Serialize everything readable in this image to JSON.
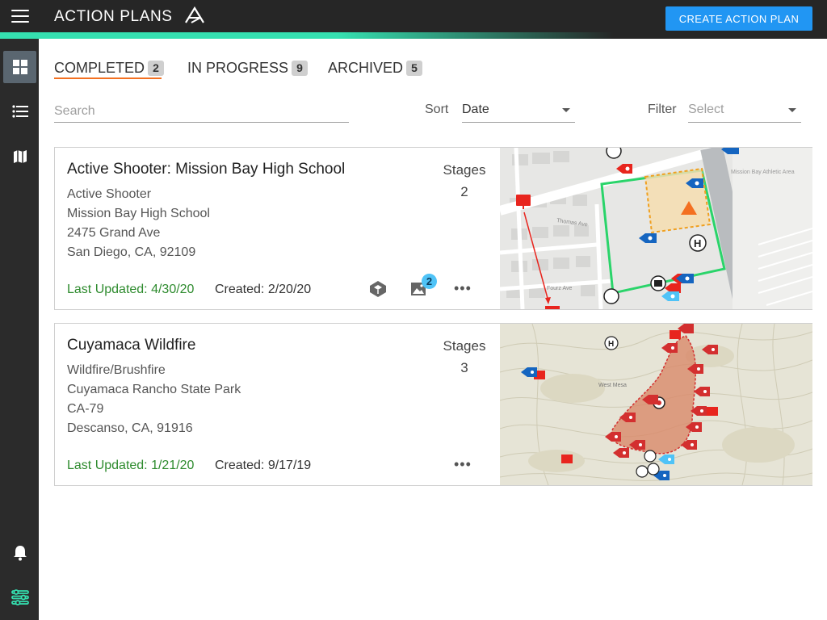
{
  "header": {
    "title": "ACTION PLANS",
    "create_button_label": "CREATE ACTION PLAN"
  },
  "tabs": [
    {
      "label": "COMPLETED",
      "count": "2",
      "active": true
    },
    {
      "label": "IN PROGRESS",
      "count": "9",
      "active": false
    },
    {
      "label": "ARCHIVED",
      "count": "5",
      "active": false
    }
  ],
  "search": {
    "placeholder": "Search",
    "value": ""
  },
  "sort": {
    "label": "Sort",
    "value": "Date"
  },
  "filter": {
    "label": "Filter",
    "placeholder": "Select"
  },
  "plans": [
    {
      "title": "Active Shooter: Mission Bay High School",
      "type": "Active Shooter",
      "location_name": "Mission Bay High School",
      "address": "2475 Grand Ave",
      "city": "San Diego, CA, 92109",
      "stages_label": "Stages",
      "stages": "2",
      "last_updated": "Last Updated: 4/30/20",
      "created": "Created: 2/20/20",
      "image_count": "2",
      "more": "•••"
    },
    {
      "title": "Cuyamaca Wildfire",
      "type": "Wildfire/Brushfire",
      "location_name": "Cuyamaca Rancho State Park",
      "address": "CA-79",
      "city": "Descanso, CA, 91916",
      "stages_label": "Stages",
      "stages": "3",
      "last_updated": "Last Updated: 1/21/20",
      "created": "Created: 9/17/19",
      "more": "•••"
    }
  ],
  "map1_labels": {
    "street_a": "Thomas Ave",
    "street_b": "Fourz Ave",
    "area": "Mission Bay Athletic Area",
    "hospital": "H"
  },
  "map2_labels": {
    "hospital": "H",
    "place": "West Mesa"
  },
  "colors": {
    "accent": "#f37021",
    "primary": "#2196f3",
    "updated": "#2e8b2e",
    "teal": "#35e0b0"
  }
}
